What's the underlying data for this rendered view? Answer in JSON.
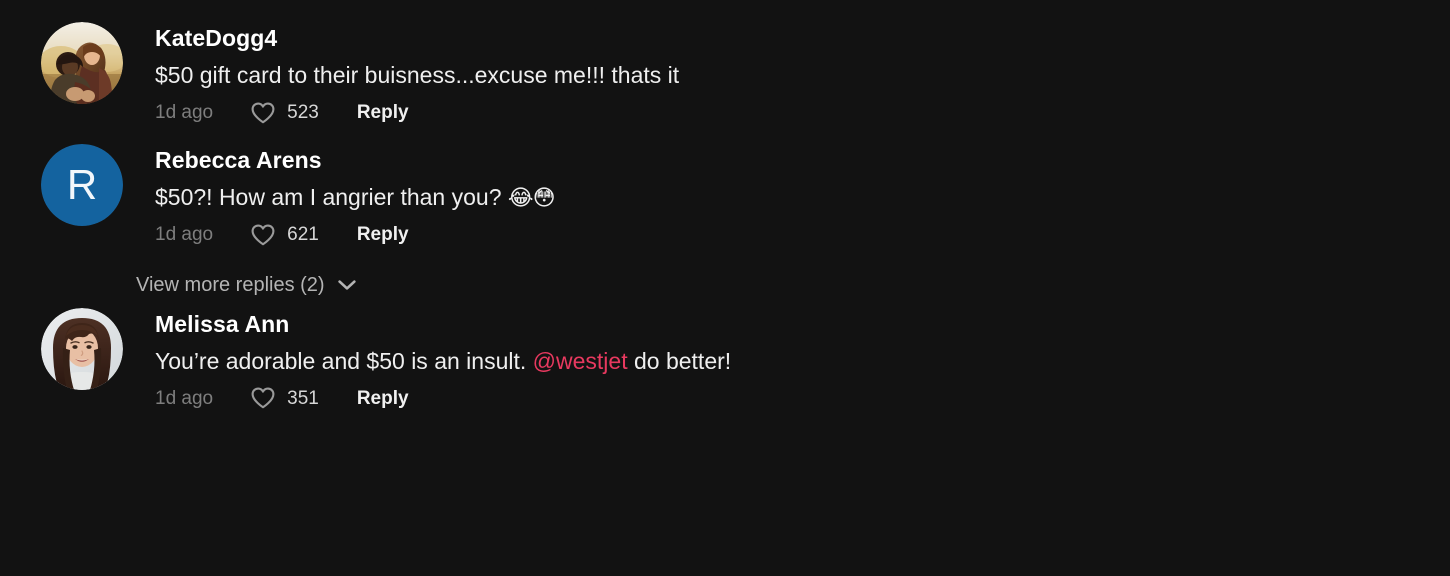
{
  "app": {
    "background_color": "#121212",
    "accent_mention_color": "#e8395f"
  },
  "comments": [
    {
      "username": "KateDogg4",
      "text_before_mention": "$50 gift card to their buisness...excuse me!!! thats it",
      "mention": "",
      "text_after_mention": "",
      "emoji": "",
      "timestamp": "1d ago",
      "like_count": "523",
      "reply_label": "Reply",
      "avatar_type": "photo",
      "avatar_initial": "",
      "avatar_bg": "#1565a8",
      "avatar_description": "couple-outdoors-golden-field"
    },
    {
      "username": "Rebecca Arens",
      "text_before_mention": "$50?! How am I angrier than you? ",
      "mention": "",
      "text_after_mention": "",
      "emoji": "😂😳",
      "timestamp": "1d ago",
      "like_count": "621",
      "reply_label": "Reply",
      "avatar_type": "initial",
      "avatar_initial": "R",
      "avatar_bg": "#14639f",
      "avatar_description": "blue-letter-avatar"
    },
    {
      "username": "Melissa Ann",
      "text_before_mention": "You’re adorable and $50 is an insult. ",
      "mention": "@westjet",
      "text_after_mention": " do better!",
      "emoji": "",
      "timestamp": "1d ago",
      "like_count": "351",
      "reply_label": "Reply",
      "avatar_type": "photo",
      "avatar_initial": "",
      "avatar_bg": "#6b5a52",
      "avatar_description": "woman-dark-hair-bangs-portrait"
    }
  ],
  "view_more_replies": {
    "label": "View more replies (2)",
    "icon": "chevron-down-icon"
  }
}
